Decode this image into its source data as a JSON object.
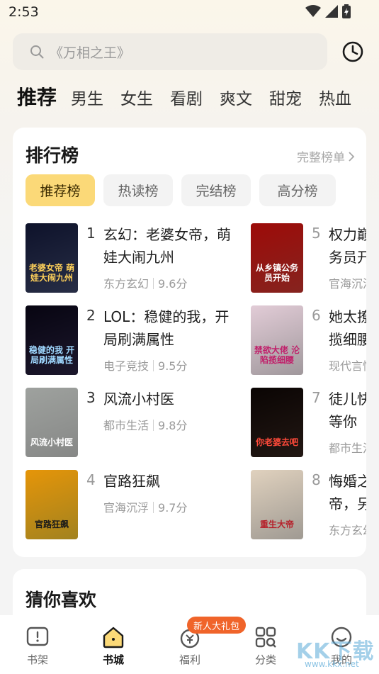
{
  "status": {
    "time": "2:53"
  },
  "search": {
    "placeholder": "《万相之王》"
  },
  "tabs": [
    {
      "label": "推荐",
      "active": true
    },
    {
      "label": "男生"
    },
    {
      "label": "女生"
    },
    {
      "label": "看剧"
    },
    {
      "label": "爽文"
    },
    {
      "label": "甜宠"
    },
    {
      "label": "热血"
    }
  ],
  "ranking": {
    "title": "排行榜",
    "more_label": "完整榜单",
    "chips": [
      "推荐榜",
      "热读榜",
      "完结榜",
      "高分榜"
    ],
    "books": [
      {
        "rank": "1",
        "title": "玄幻：老婆女帝，萌娃大闹九州",
        "genre": "东方玄幻",
        "score": "9.6分",
        "cover_text": "老婆女帝 萌娃大闹九州",
        "cover_bg": "#3b4468",
        "cover_fg": "#ffd15a"
      },
      {
        "rank": "2",
        "title": "LOL：稳健的我，开局刷满属性",
        "genre": "电子竞技",
        "score": "9.5分",
        "cover_text": "稳健的我 开局刷满属性",
        "cover_bg": "#2a2342",
        "cover_fg": "#9fd8ff"
      },
      {
        "rank": "3",
        "title": "风流小村医",
        "genre": "都市生活",
        "score": "9.8分",
        "cover_text": "风流小村医",
        "cover_bg": "#c9cbc9",
        "cover_fg": "#ffffff"
      },
      {
        "rank": "4",
        "title": "官路狂飙",
        "genre": "官海沉浮",
        "score": "9.7分",
        "cover_text": "官路狂飙",
        "cover_bg": "#f2c32f",
        "cover_fg": "#1a1a1a"
      },
      {
        "rank": "5",
        "title": "权力巅峰：从乡镇公务员开始",
        "genre": "官海沉浮",
        "score": "",
        "cover_text": "从乡镇公务员开始",
        "cover_bg": "#c8352e",
        "cover_fg": "#ffffff"
      },
      {
        "rank": "6",
        "title": "她太撩人，大佬沦陷揽细腰",
        "genre": "现代言情",
        "score": "",
        "cover_text": "禁欲大佬 沦陷揽细腰",
        "cover_bg": "#f0e4ea",
        "cover_fg": "#c01f6a"
      },
      {
        "rank": "7",
        "title": "徒儿快下山，你老婆等你",
        "genre": "都市生活",
        "score": "",
        "cover_text": "你老婆去吧",
        "cover_bg": "#33231d",
        "cover_fg": "#ff4a3a"
      },
      {
        "rank": "8",
        "title": "悔婚之后，我成女帝，另",
        "genre": "东方玄幻",
        "score": "",
        "cover_text": "重生大帝",
        "cover_bg": "#efe7dc",
        "cover_fg": "#b5202a"
      }
    ]
  },
  "guess": {
    "title": "猜你喜欢"
  },
  "nav": {
    "items": [
      {
        "label": "书架",
        "icon": "bookshelf-icon"
      },
      {
        "label": "书城",
        "icon": "bookstore-icon",
        "active": true
      },
      {
        "label": "福利",
        "icon": "welfare-icon"
      },
      {
        "label": "分类",
        "icon": "category-icon"
      },
      {
        "label": "我的",
        "icon": "profile-icon"
      }
    ],
    "badge": "新人大礼包"
  },
  "watermark": {
    "text": "KK下载",
    "url": "www.kkx.net"
  }
}
